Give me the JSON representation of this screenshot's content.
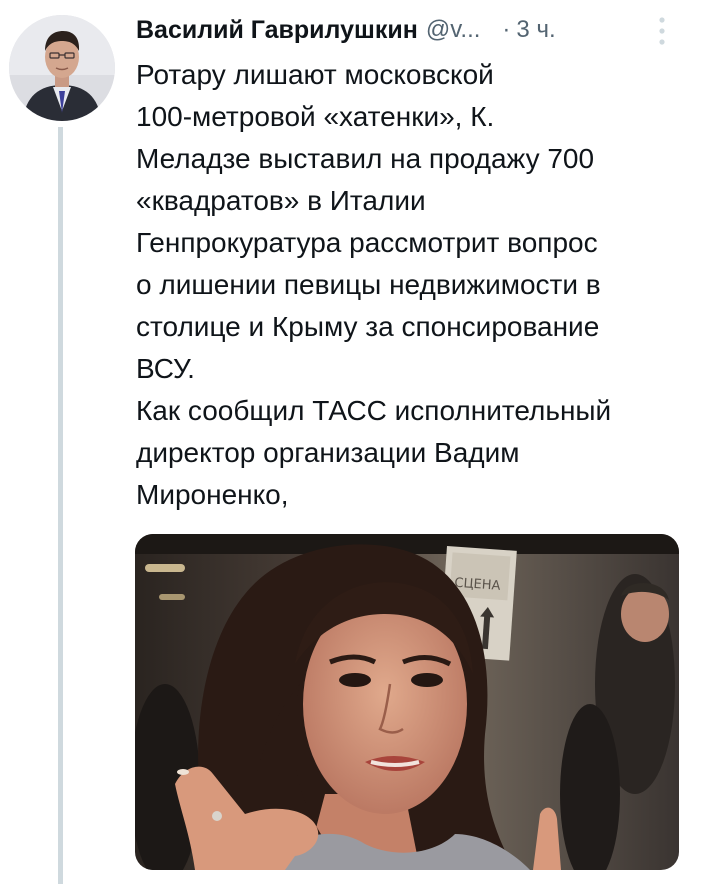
{
  "tweet": {
    "author": {
      "display_name": "Василий Гаврилушкин",
      "handle": "@v...",
      "avatar_icon": "user-avatar-photo"
    },
    "separator": "·",
    "timestamp": "3 ч.",
    "more_icon": "more-vertical-icon",
    "text_lines": [
      "Ротару лишают московской",
      "100-метровой «хатенки», К.",
      "Меладзе выставил на продажу 700",
      "«квадратов» в Италии",
      "Генпрокуратура рассмотрит вопрос",
      "о лишении певицы недвижимости в",
      "столице и Крыму за спонсирование",
      "ВСУ.",
      "Как сообщил ТАСС исполнительный",
      "директор организации Вадим",
      "Мироненко,"
    ],
    "media": {
      "sign_text": "СЦЕНА"
    }
  },
  "colors": {
    "text_primary": "#0f1419",
    "text_secondary": "#536471",
    "thread_line": "#cfd9de"
  }
}
